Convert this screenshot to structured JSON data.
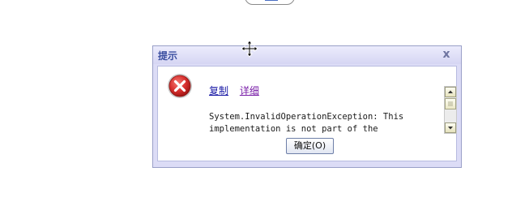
{
  "dialog": {
    "title": "提示",
    "close_label": "x",
    "links": {
      "copy": "复制",
      "detail": "详细"
    },
    "message": "System.InvalidOperationException: This\nimplementation is not part of the",
    "ok_label": "确定(O)"
  },
  "icons": {
    "error": "error-circle-icon",
    "cursor": "move-cursor-icon",
    "scroll_up": "arrow-up-icon",
    "scroll_down": "arrow-down-icon"
  },
  "colors": {
    "title_text": "#3a4ea0",
    "dialog_frame": "#dcdcf6",
    "error_red": "#d8302f",
    "link_copy": "#1a1aa6",
    "link_detail": "#7a1fa8"
  }
}
